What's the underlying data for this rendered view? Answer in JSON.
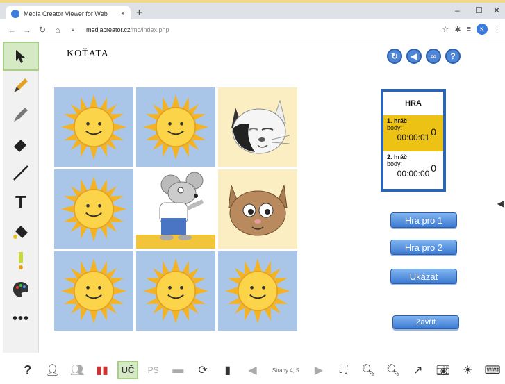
{
  "browser": {
    "tab_title": "Media Creator Viewer for Web",
    "tab_close": "×",
    "new_tab": "+",
    "url_host": "mediacreator.cz",
    "url_path": "/mc/index.php",
    "avatar_letter": "K",
    "window_controls": [
      "–",
      "☐",
      "✕"
    ]
  },
  "page": {
    "title": "KOŤATA"
  },
  "score_panel": {
    "heading": "HRA",
    "players": [
      {
        "name": "1. hráč",
        "label": "body:",
        "score": "0",
        "time": "00:00:01"
      },
      {
        "name": "2. hráč",
        "label": "body:",
        "score": "0",
        "time": "00:00:00"
      }
    ]
  },
  "buttons": {
    "play_one": "Hra pro 1",
    "play_two": "Hra pro 2",
    "show": "Ukázat",
    "close": "Zavřít"
  },
  "grid": [
    "sun",
    "sun",
    "cat-black-white",
    "sun",
    "mouse",
    "cat-brown",
    "sun",
    "sun",
    "sun"
  ],
  "bottom_toolbar": {
    "uc_label": "UČ",
    "ps_label": "PS",
    "pages_label": "Strany 4, 5"
  },
  "colors": {
    "card_back": "#a9c6e8",
    "card_face": "#fbeec2",
    "accent_blue": "#2b64b3",
    "player_active": "#ecc215"
  }
}
